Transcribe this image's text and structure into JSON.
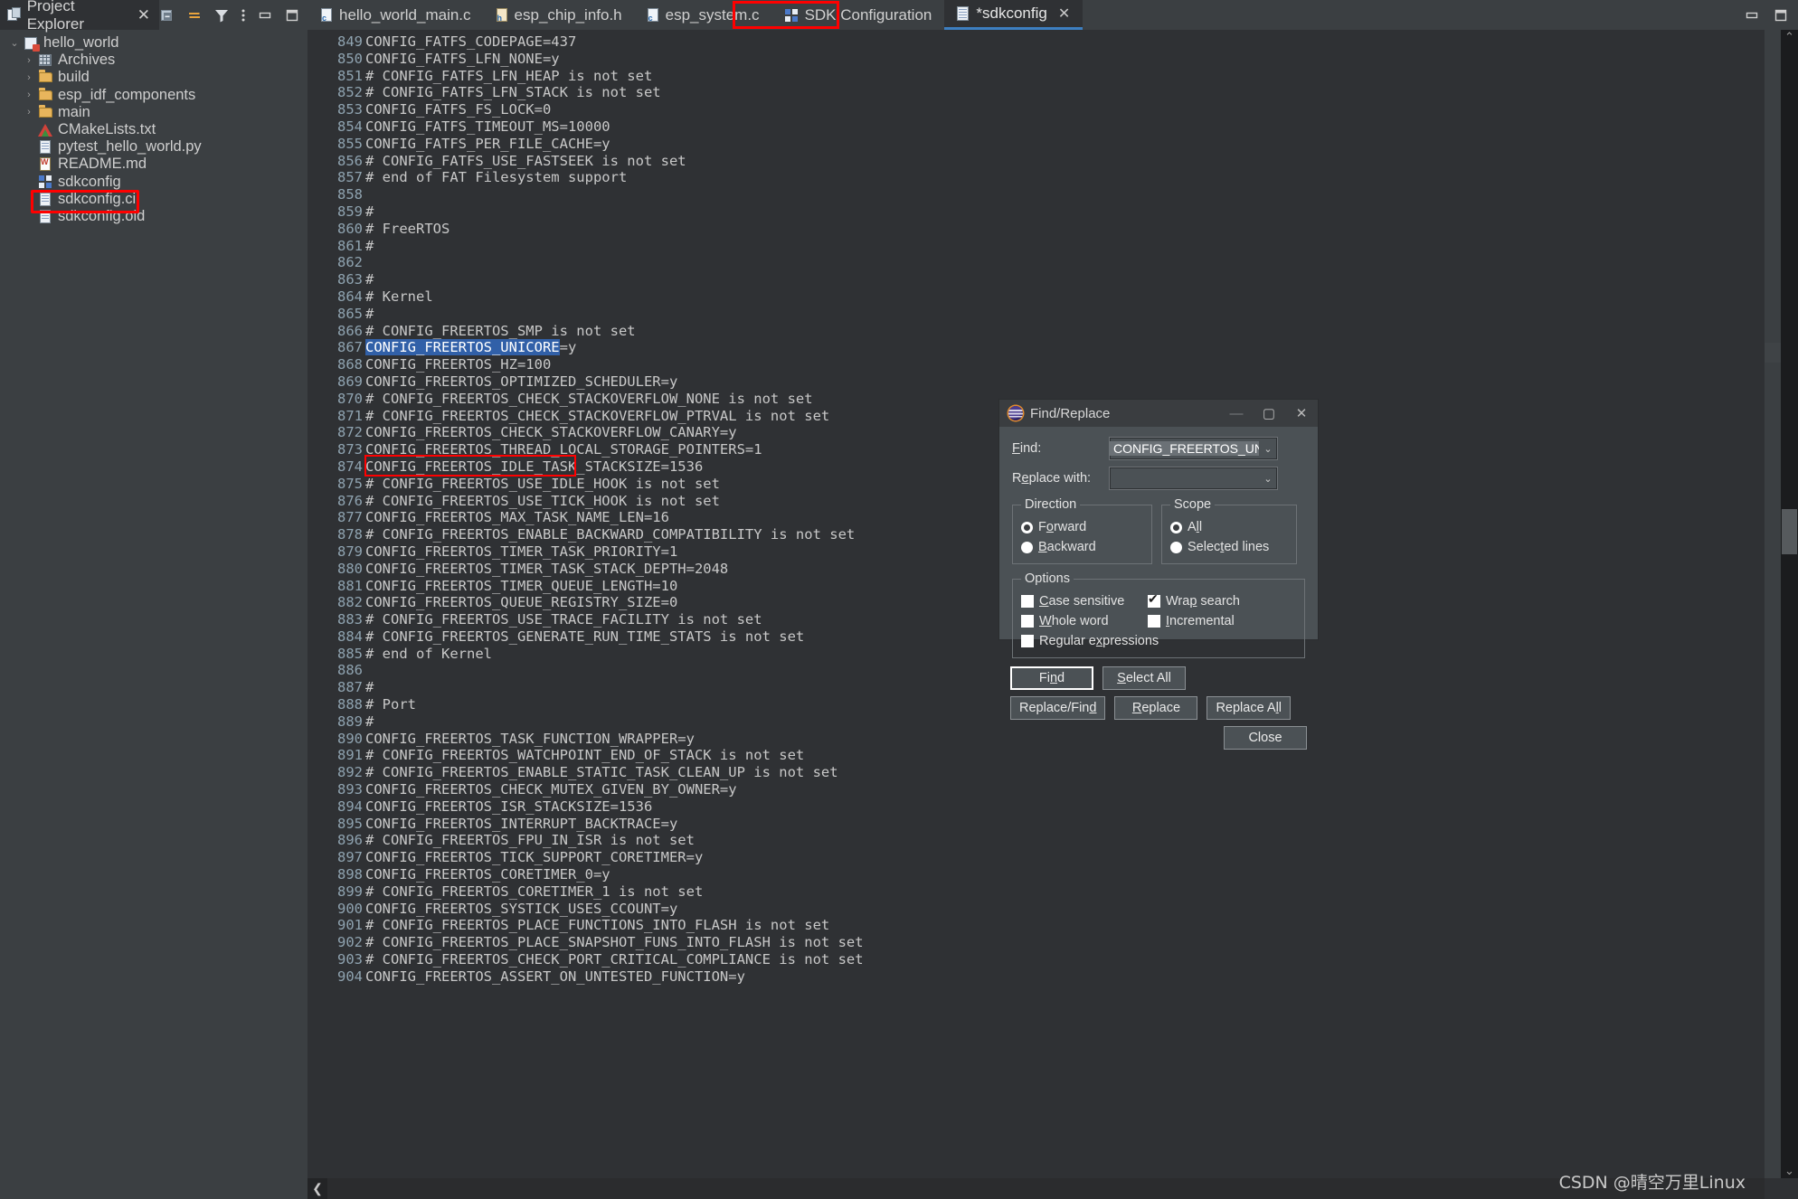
{
  "explorer": {
    "tab_label": "Project Explorer",
    "tab_close": "✕",
    "toolbar": [
      {
        "name": "collapse-all-icon",
        "glyph": "▣"
      },
      {
        "name": "link-with-editor-icon",
        "glyph": "⇆"
      },
      {
        "name": "view-filter-icon",
        "glyph": "▼"
      },
      {
        "name": "view-menu-icon",
        "glyph": "⋮"
      },
      {
        "name": "minimize-view-icon",
        "glyph": "▬"
      },
      {
        "name": "maximize-view-icon",
        "glyph": "▢"
      }
    ],
    "tree": [
      {
        "label": "hello_world",
        "depth": 0,
        "arrow": "⌄",
        "icon": "project-icon"
      },
      {
        "label": "Archives",
        "depth": 1,
        "arrow": "›",
        "icon": "archives-icon"
      },
      {
        "label": "build",
        "depth": 1,
        "arrow": "›",
        "icon": "folder-icon"
      },
      {
        "label": "esp_idf_components",
        "depth": 1,
        "arrow": "›",
        "icon": "folder-icon"
      },
      {
        "label": "main",
        "depth": 1,
        "arrow": "›",
        "icon": "source-folder-icon"
      },
      {
        "label": "CMakeLists.txt",
        "depth": 1,
        "arrow": "",
        "icon": "cmake-file-icon"
      },
      {
        "label": "pytest_hello_world.py",
        "depth": 1,
        "arrow": "",
        "icon": "file-icon"
      },
      {
        "label": "README.md",
        "depth": 1,
        "arrow": "",
        "icon": "markdown-file-icon"
      },
      {
        "label": "sdkconfig",
        "depth": 1,
        "arrow": "",
        "icon": "sdkconfig-file-icon",
        "highlight": true
      },
      {
        "label": "sdkconfig.ci",
        "depth": 1,
        "arrow": "",
        "icon": "file-icon"
      },
      {
        "label": "sdkconfig.old",
        "depth": 1,
        "arrow": "",
        "icon": "file-icon"
      }
    ]
  },
  "window_controls": [
    {
      "name": "restore-window-icon",
      "glyph": "▬"
    },
    {
      "name": "maximize-window-icon",
      "glyph": "▢"
    }
  ],
  "editor_tabs": [
    {
      "label": "hello_world_main.c",
      "icon": "c-file-icon",
      "active": false,
      "closeable": false
    },
    {
      "label": "esp_chip_info.h",
      "icon": "h-file-icon",
      "active": false,
      "closeable": false
    },
    {
      "label": "esp_system.c",
      "icon": "c-file-icon",
      "active": false,
      "closeable": false
    },
    {
      "label": "SDK Configuration",
      "icon": "sdk-config-icon",
      "active": false,
      "closeable": false
    },
    {
      "label": "*sdkconfig",
      "icon": "file-icon",
      "active": true,
      "closeable": true,
      "close_glyph": "✕"
    }
  ],
  "code": {
    "selection": {
      "line": 867,
      "text": "CONFIG_FREERTOS_UNICORE"
    },
    "lines": [
      {
        "n": 849,
        "t": "CONFIG_FATFS_CODEPAGE=437"
      },
      {
        "n": 850,
        "t": "CONFIG_FATFS_LFN_NONE=y"
      },
      {
        "n": 851,
        "t": "# CONFIG_FATFS_LFN_HEAP is not set"
      },
      {
        "n": 852,
        "t": "# CONFIG_FATFS_LFN_STACK is not set"
      },
      {
        "n": 853,
        "t": "CONFIG_FATFS_FS_LOCK=0"
      },
      {
        "n": 854,
        "t": "CONFIG_FATFS_TIMEOUT_MS=10000"
      },
      {
        "n": 855,
        "t": "CONFIG_FATFS_PER_FILE_CACHE=y"
      },
      {
        "n": 856,
        "t": "# CONFIG_FATFS_USE_FASTSEEK is not set"
      },
      {
        "n": 857,
        "t": "# end of FAT Filesystem support"
      },
      {
        "n": 858,
        "t": ""
      },
      {
        "n": 859,
        "t": "#"
      },
      {
        "n": 860,
        "t": "# FreeRTOS"
      },
      {
        "n": 861,
        "t": "#"
      },
      {
        "n": 862,
        "t": ""
      },
      {
        "n": 863,
        "t": "#"
      },
      {
        "n": 864,
        "t": "# Kernel"
      },
      {
        "n": 865,
        "t": "#"
      },
      {
        "n": 866,
        "t": "# CONFIG_FREERTOS_SMP is not set"
      },
      {
        "n": 867,
        "t": "CONFIG_FREERTOS_UNICORE=y",
        "sel_len": 23
      },
      {
        "n": 868,
        "t": "CONFIG_FREERTOS_HZ=100"
      },
      {
        "n": 869,
        "t": "CONFIG_FREERTOS_OPTIMIZED_SCHEDULER=y"
      },
      {
        "n": 870,
        "t": "# CONFIG_FREERTOS_CHECK_STACKOVERFLOW_NONE is not set"
      },
      {
        "n": 871,
        "t": "# CONFIG_FREERTOS_CHECK_STACKOVERFLOW_PTRVAL is not set"
      },
      {
        "n": 872,
        "t": "CONFIG_FREERTOS_CHECK_STACKOVERFLOW_CANARY=y"
      },
      {
        "n": 873,
        "t": "CONFIG_FREERTOS_THREAD_LOCAL_STORAGE_POINTERS=1"
      },
      {
        "n": 874,
        "t": "CONFIG_FREERTOS_IDLE_TASK_STACKSIZE=1536"
      },
      {
        "n": 875,
        "t": "# CONFIG_FREERTOS_USE_IDLE_HOOK is not set"
      },
      {
        "n": 876,
        "t": "# CONFIG_FREERTOS_USE_TICK_HOOK is not set"
      },
      {
        "n": 877,
        "t": "CONFIG_FREERTOS_MAX_TASK_NAME_LEN=16"
      },
      {
        "n": 878,
        "t": "# CONFIG_FREERTOS_ENABLE_BACKWARD_COMPATIBILITY is not set"
      },
      {
        "n": 879,
        "t": "CONFIG_FREERTOS_TIMER_TASK_PRIORITY=1"
      },
      {
        "n": 880,
        "t": "CONFIG_FREERTOS_TIMER_TASK_STACK_DEPTH=2048"
      },
      {
        "n": 881,
        "t": "CONFIG_FREERTOS_TIMER_QUEUE_LENGTH=10"
      },
      {
        "n": 882,
        "t": "CONFIG_FREERTOS_QUEUE_REGISTRY_SIZE=0"
      },
      {
        "n": 883,
        "t": "# CONFIG_FREERTOS_USE_TRACE_FACILITY is not set"
      },
      {
        "n": 884,
        "t": "# CONFIG_FREERTOS_GENERATE_RUN_TIME_STATS is not set"
      },
      {
        "n": 885,
        "t": "# end of Kernel"
      },
      {
        "n": 886,
        "t": ""
      },
      {
        "n": 887,
        "t": "#"
      },
      {
        "n": 888,
        "t": "# Port"
      },
      {
        "n": 889,
        "t": "#"
      },
      {
        "n": 890,
        "t": "CONFIG_FREERTOS_TASK_FUNCTION_WRAPPER=y"
      },
      {
        "n": 891,
        "t": "# CONFIG_FREERTOS_WATCHPOINT_END_OF_STACK is not set"
      },
      {
        "n": 892,
        "t": "# CONFIG_FREERTOS_ENABLE_STATIC_TASK_CLEAN_UP is not set"
      },
      {
        "n": 893,
        "t": "CONFIG_FREERTOS_CHECK_MUTEX_GIVEN_BY_OWNER=y"
      },
      {
        "n": 894,
        "t": "CONFIG_FREERTOS_ISR_STACKSIZE=1536"
      },
      {
        "n": 895,
        "t": "CONFIG_FREERTOS_INTERRUPT_BACKTRACE=y"
      },
      {
        "n": 896,
        "t": "# CONFIG_FREERTOS_FPU_IN_ISR is not set"
      },
      {
        "n": 897,
        "t": "CONFIG_FREERTOS_TICK_SUPPORT_CORETIMER=y"
      },
      {
        "n": 898,
        "t": "CONFIG_FREERTOS_CORETIMER_0=y"
      },
      {
        "n": 899,
        "t": "# CONFIG_FREERTOS_CORETIMER_1 is not set"
      },
      {
        "n": 900,
        "t": "CONFIG_FREERTOS_SYSTICK_USES_CCOUNT=y"
      },
      {
        "n": 901,
        "t": "# CONFIG_FREERTOS_PLACE_FUNCTIONS_INTO_FLASH is not set"
      },
      {
        "n": 902,
        "t": "# CONFIG_FREERTOS_PLACE_SNAPSHOT_FUNS_INTO_FLASH is not set"
      },
      {
        "n": 903,
        "t": "# CONFIG_FREERTOS_CHECK_PORT_CRITICAL_COMPLIANCE is not set"
      },
      {
        "n": 904,
        "t": "CONFIG_FREERTOS_ASSERT_ON_UNTESTED_FUNCTION=y"
      }
    ]
  },
  "scroll": {
    "up_chevron": "⌃",
    "down_chevron": "⌄",
    "h_left_chevron": "❮"
  },
  "find_replace": {
    "title": "Find/Replace",
    "title_icon": "eclipse-icon",
    "minimize_glyph": "—",
    "maximize_glyph": "▢",
    "close_glyph": "✕",
    "find_label": "Find:",
    "find_value": "CONFIG_FREERTOS_UNIC",
    "replace_label": "Replace with:",
    "replace_value": "",
    "dropdown_glyph": "⌄",
    "direction": {
      "legend": "Direction",
      "options": [
        {
          "label": "Forward",
          "selected": true
        },
        {
          "label": "Backward",
          "selected": false
        }
      ]
    },
    "scope": {
      "legend": "Scope",
      "options": [
        {
          "label": "All",
          "selected": true
        },
        {
          "label": "Selected lines",
          "selected": false
        }
      ]
    },
    "options": {
      "legend": "Options",
      "items": [
        {
          "label": "Case sensitive",
          "checked": false
        },
        {
          "label": "Wrap search",
          "checked": true
        },
        {
          "label": "Whole word",
          "checked": false
        },
        {
          "label": "Incremental",
          "checked": false
        },
        {
          "label": "Regular expressions",
          "checked": false
        }
      ]
    },
    "buttons": {
      "find": "Find",
      "select_all": "Select All",
      "replace_find": "Replace/Find",
      "replace": "Replace",
      "replace_all": "Replace All",
      "close": "Close"
    }
  },
  "watermark": "CSDN @晴空万里Linux",
  "colors": {
    "accent_blue": "#3d7fc1",
    "selection_blue": "#3160a8",
    "annotation_red": "#ff0000",
    "panel_bg": "#3b3f42",
    "editor_bg": "#2f3134",
    "dialog_bg": "#4b5155",
    "line_number": "#8fa3b0"
  }
}
